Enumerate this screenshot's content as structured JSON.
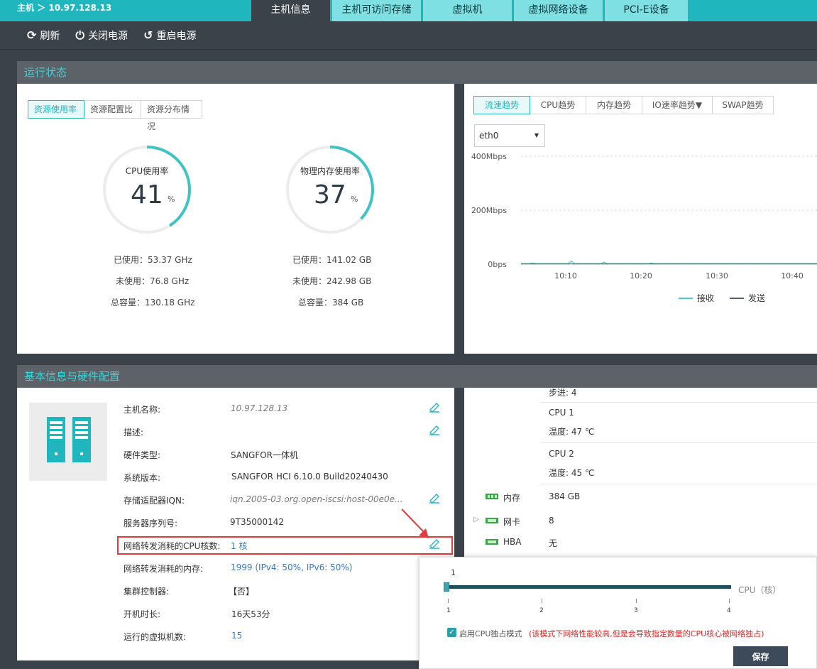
{
  "breadcrumb": "主机 ＞ 10.97.128.13",
  "tabs": [
    {
      "label": "主机信息",
      "active": true
    },
    {
      "label": "主机可访问存储",
      "active": false
    },
    {
      "label": "虚拟机",
      "active": false
    },
    {
      "label": "虚拟网络设备",
      "active": false
    },
    {
      "label": "PCI-E设备",
      "active": false
    }
  ],
  "toolbar": {
    "refresh": "刷新",
    "power_off": "关闭电源",
    "restart": "重启电源"
  },
  "run_status": {
    "title": "运行状态",
    "subtabs": [
      "资源使用率",
      "资源配置比",
      "资源分布情况"
    ],
    "cpu": {
      "title": "CPU使用率",
      "value": "41",
      "unit": "%",
      "used": "已使用：53.37 GHz",
      "free": "未使用：76.8 GHz",
      "total": "总容量：130.18 GHz",
      "fraction": 0.41
    },
    "mem": {
      "title": "物理内存使用率",
      "value": "37",
      "unit": "%",
      "used": "已使用：141.02 GB",
      "free": "未使用：242.98 GB",
      "total": "总容量：384 GB",
      "fraction": 0.37
    }
  },
  "trend": {
    "subtabs": [
      "流速趋势",
      "CPU趋势",
      "内存趋势",
      "IO速率趋势▼",
      "SWAP趋势"
    ],
    "interface": "eth0",
    "y_labels": [
      "400Mbps",
      "200Mbps",
      "0bps"
    ],
    "x_labels": [
      "10:10",
      "10:20",
      "10:30",
      "10:40"
    ],
    "legend": [
      "接收",
      "发送"
    ]
  },
  "chart_data": {
    "type": "line",
    "title": "",
    "xlabel": "",
    "ylabel": "",
    "ylim": [
      0,
      400
    ],
    "x": [
      "10:10",
      "10:20",
      "10:30",
      "10:40"
    ],
    "series": [
      {
        "name": "接收",
        "values": [
          2,
          2,
          2,
          2
        ]
      },
      {
        "name": "发送",
        "values": [
          1,
          1,
          1,
          1
        ]
      }
    ],
    "colors": {
      "接收": "#4fc9c9",
      "发送": "#556070"
    },
    "legend": "bottom-right"
  },
  "basic": {
    "title": "基本信息与硬件配置",
    "rows": [
      {
        "label": "主机名称:",
        "value": "10.97.128.13"
      },
      {
        "label": "描述:",
        "value": ""
      },
      {
        "label": "硬件类型:",
        "value": "SANGFOR一体机"
      },
      {
        "label": "系统版本:",
        "value": "SANGFOR HCI 6.10.0 Build20240430"
      },
      {
        "label": "存储适配器IQN:",
        "value": "iqn.2005-03.org.open-iscsi:host-00e0e..."
      },
      {
        "label": "服务器序列号:",
        "value": "9T35000142"
      },
      {
        "label": "网络转发消耗的CPU核数:",
        "value": "1 核"
      },
      {
        "label": "网络转发消耗的内存:",
        "value": "1999 (IPv4: 50%, IPv6: 50%)"
      },
      {
        "label": "集群控制器:",
        "value": "【否】"
      },
      {
        "label": "开机时长:",
        "value": "16天53分"
      },
      {
        "label": "运行的虚拟机数:",
        "value": "15"
      }
    ]
  },
  "hardware": {
    "step": "步进:  4",
    "cpu1": "CPU 1",
    "cpu1_temp": "温度: 47 ℃",
    "cpu2": "CPU 2",
    "cpu2_temp": "温度: 45 ℃",
    "mem_label": "内存",
    "mem_value": "384 GB",
    "nic_label": "网卡",
    "nic_value": "8",
    "hba_label": "HBA",
    "hba_value": "无"
  },
  "popup": {
    "slider_value": "1",
    "slider_unit": "CPU（核）",
    "ticks": [
      "1",
      "2",
      "3",
      "4"
    ],
    "checkbox_label": "启用CPU独占模式",
    "warning": "(该模式下网络性能较高,但是会导致指定数量的CPU核心被网络独占)",
    "save": "保存",
    "slider_fraction": 0.0
  }
}
